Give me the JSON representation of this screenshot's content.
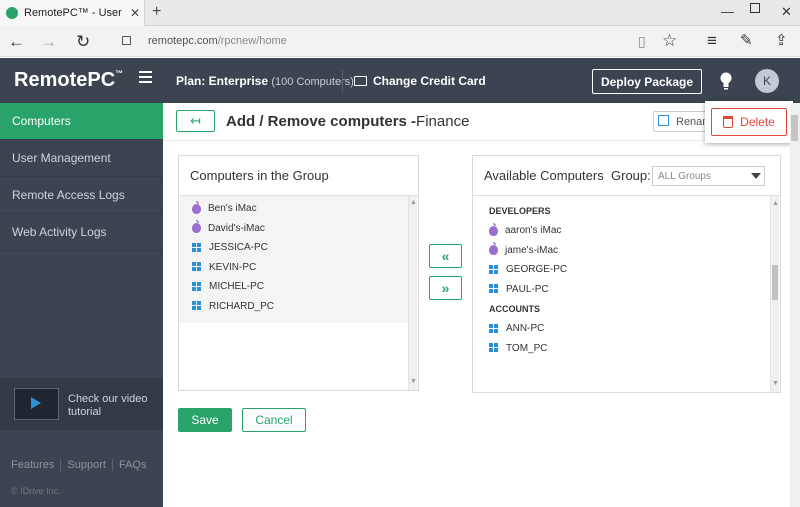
{
  "browser": {
    "tab_title": "RemotePC™ - User Man",
    "url_host": "remotepc.com",
    "url_path": "/rpcnew/home"
  },
  "app": {
    "logo": "RemotePC",
    "logo_tm": "™",
    "plan_label": "Plan: Enterprise",
    "plan_sub": "(100 Computers)",
    "change_card": "Change Credit Card",
    "deploy": "Deploy Package",
    "avatar_initial": "K"
  },
  "sidebar": {
    "items": [
      {
        "label": "Computers"
      },
      {
        "label": "User Management"
      },
      {
        "label": "Remote Access Logs"
      },
      {
        "label": "Web Activity Logs"
      }
    ],
    "video_text": "Check our video tutorial",
    "footer_links": [
      "Features",
      "Support",
      "FAQs"
    ],
    "copyright": "© IDrive Inc."
  },
  "page": {
    "title": "Add / Remove computers -",
    "group": "Finance",
    "rename": "Rename",
    "delete": "Delete",
    "back": "↤"
  },
  "group_panel": {
    "title": "Computers in the Group",
    "items": [
      {
        "name": "Ben's iMac",
        "os": "apple"
      },
      {
        "name": "David's-iMac",
        "os": "apple"
      },
      {
        "name": "JESSICA-PC",
        "os": "windows"
      },
      {
        "name": "KEVIN-PC",
        "os": "windows"
      },
      {
        "name": "MICHEL-PC",
        "os": "windows"
      },
      {
        "name": "RICHARD_PC",
        "os": "windows"
      }
    ]
  },
  "transfer": {
    "left": "«",
    "right": "»"
  },
  "available_panel": {
    "title": "Available Computers",
    "group_label": "Group:",
    "group_value": "ALL Groups",
    "groups": [
      {
        "name": "DEVELOPERS",
        "items": [
          {
            "name": "aaron's iMac",
            "os": "apple"
          },
          {
            "name": "jame's-iMac",
            "os": "apple"
          },
          {
            "name": "GEORGE-PC",
            "os": "windows"
          },
          {
            "name": "PAUL-PC",
            "os": "windows"
          }
        ]
      },
      {
        "name": "ACCOUNTS",
        "items": [
          {
            "name": "ANN-PC",
            "os": "windows"
          },
          {
            "name": "TOM_PC",
            "os": "windows"
          }
        ]
      }
    ]
  },
  "actions": {
    "save": "Save",
    "cancel": "Cancel"
  },
  "colors": {
    "accent": "#2aa36b",
    "header": "#3b4450",
    "danger": "#e0473a",
    "windows": "#2b8fd6",
    "apple": "#9b6fcf"
  }
}
